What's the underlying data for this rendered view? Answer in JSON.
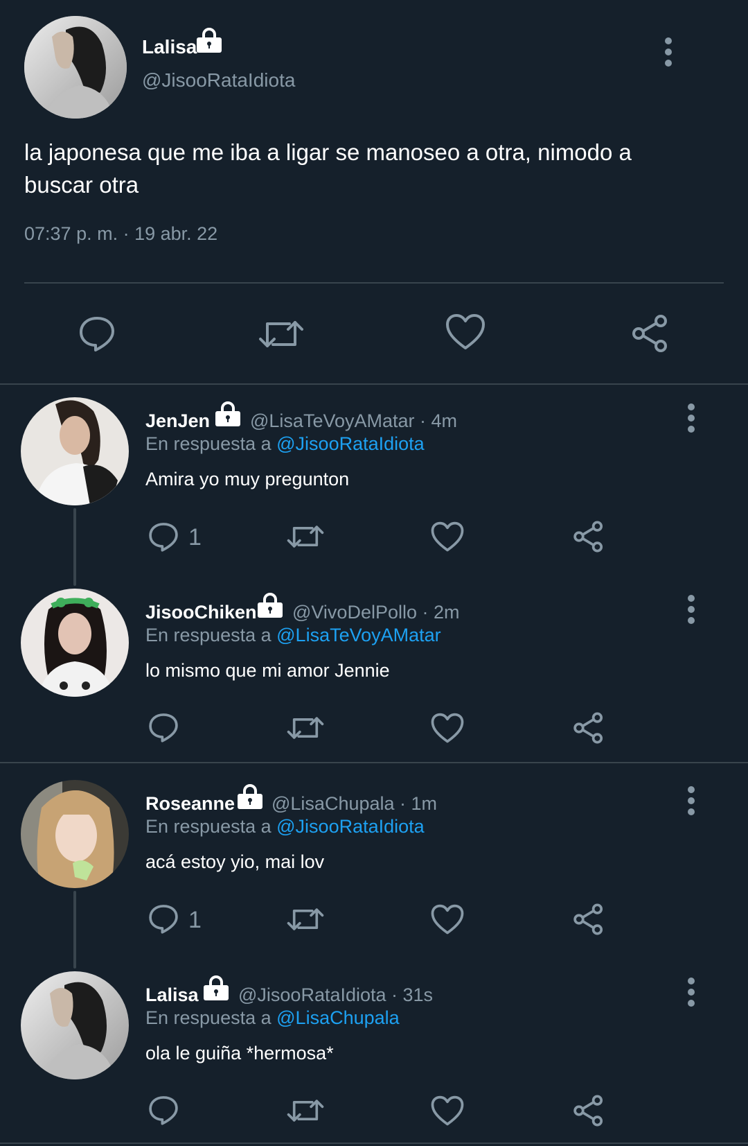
{
  "main_tweet": {
    "name": "Lalisa",
    "handle": "@JisooRataIdiota",
    "text": "la japonesa que me iba a ligar se manoseo a otra, nimodo a buscar otra",
    "timestamp": "07:37 p. m. · 19 abr. 22"
  },
  "replies": [
    {
      "name": "JenJen",
      "meta": "@LisaTeVoyAMatar · 4m",
      "reply_prefix": "En respuesta a",
      "reply_to": "@JisooRataIdiota",
      "text": "Amira yo muy pregunton",
      "reply_count": "1"
    },
    {
      "name": "JisooChiken",
      "meta": "@VivoDelPollo · 2m",
      "reply_prefix": "En respuesta a",
      "reply_to": "@LisaTeVoyAMatar",
      "text": "lo mismo que mi amor Jennie",
      "reply_count": ""
    },
    {
      "name": "Roseanne",
      "meta": "@LisaChupala · 1m",
      "reply_prefix": "En respuesta a",
      "reply_to": "@JisooRataIdiota",
      "text": "acá estoy yio, mai lov",
      "reply_count": "1"
    },
    {
      "name": "Lalisa",
      "meta": "@JisooRataIdiota · 31s",
      "reply_prefix": "En respuesta a",
      "reply_to": "@LisaChupala",
      "text": "ola le guiña *hermosa*",
      "reply_count": ""
    }
  ],
  "colors": {
    "background": "#15202b",
    "secondary_text": "#8899a6",
    "link": "#1da1f2",
    "divider": "#38444d"
  },
  "icons": [
    "lock-icon",
    "more-options-icon",
    "reply-icon",
    "retweet-icon",
    "like-icon",
    "share-icon"
  ]
}
